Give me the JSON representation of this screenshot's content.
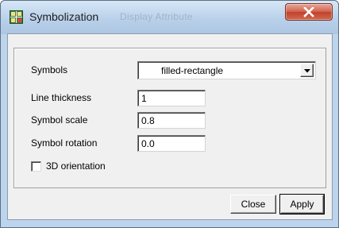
{
  "window": {
    "title": "Symbolization",
    "background_title": "Display Attribute"
  },
  "form": {
    "symbols": {
      "label": "Symbols",
      "value": "filled-rectangle"
    },
    "line_thickness": {
      "label": "Line thickness",
      "value": "1"
    },
    "symbol_scale": {
      "label": "Symbol scale",
      "value": "0.8"
    },
    "symbol_rotation": {
      "label": "Symbol rotation",
      "value": "0.0"
    },
    "orientation_3d": {
      "label": "3D orientation",
      "checked": false
    }
  },
  "buttons": {
    "close": "Close",
    "apply": "Apply"
  },
  "icons": {
    "app": "app-grid-icon",
    "close": "close-x-icon",
    "dropdown": "chevron-down-icon"
  },
  "colors": {
    "close_button": "#c2412b",
    "title_bar": "#b7cfe9"
  }
}
